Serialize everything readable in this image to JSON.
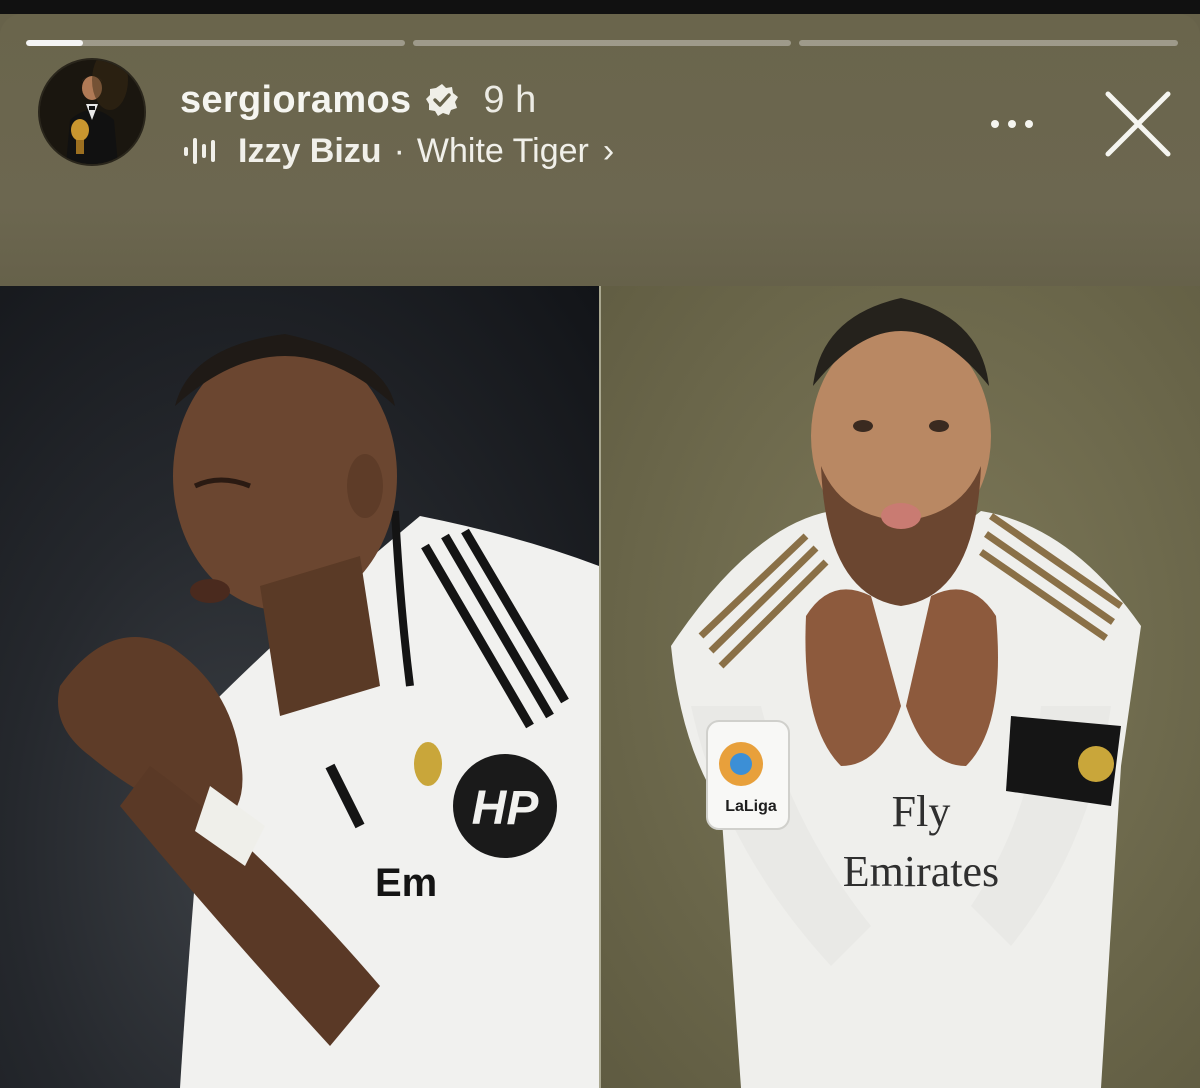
{
  "story": {
    "progress": {
      "segments": 3,
      "current_segment_fill": 0.15
    },
    "user": {
      "username": "sergioramos",
      "verified": true,
      "time": "9 h"
    },
    "music": {
      "artist": "Izzy Bizu",
      "separator": "·",
      "song": "White Tiger",
      "chevron": "›"
    },
    "icons": {
      "verified": "verified-badge-icon",
      "music": "audio-bars-icon",
      "more": "more-options-icon",
      "close": "close-icon"
    },
    "photo_text": {
      "left_sponsor": "HP",
      "right_sponsor_line1": "Fly",
      "right_sponsor_line2": "Emirates",
      "laliga": "LaLiga"
    },
    "colors": {
      "header_bg": "#6a654c",
      "text": "#f5f5f0",
      "progress_track": "rgba(255,255,255,0.35)",
      "progress_fill": "#f4f4f4"
    }
  }
}
